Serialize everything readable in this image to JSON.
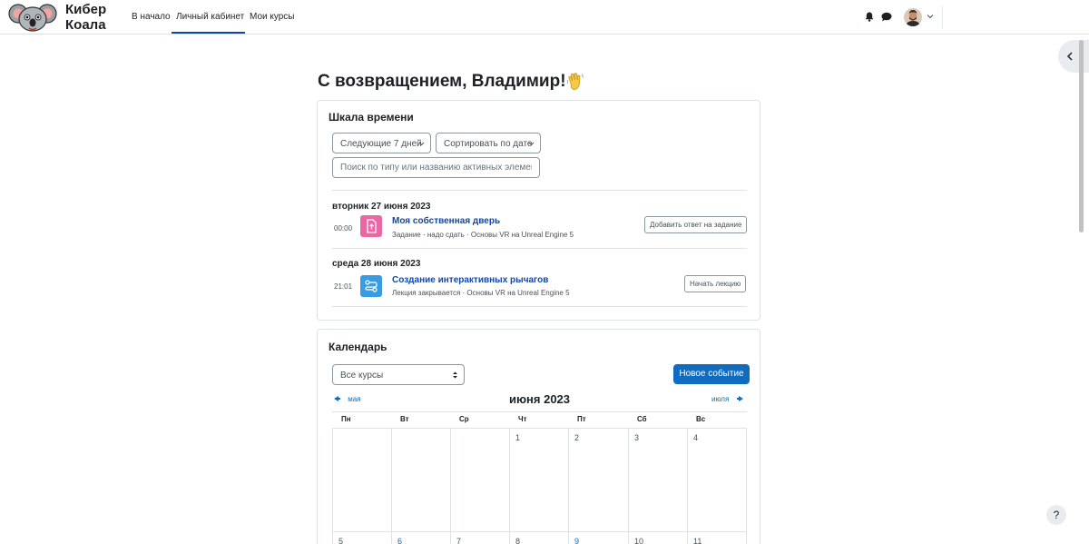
{
  "navbar": {
    "brand_line1": "Кибер",
    "brand_line2": "Коала",
    "links": [
      "В начало",
      "Личный кабинет",
      "Мои курсы"
    ]
  },
  "welcome": "С возвращением, Владимир!",
  "timeline": {
    "title": "Шкала времени",
    "filter_label": "Следующие 7 дней",
    "sort_label": "Сортировать по дате",
    "search_placeholder": "Поиск по типу или названию активных элемен",
    "groups": [
      {
        "date": "вторник 27 июня 2023",
        "time": "00:00",
        "title": "Моя собственная дверь",
        "subtitle": "Задание · надо сдать · Основы VR на Unreal Engine 5",
        "action": "Добавить ответ на задание",
        "icon_color": "#eb66a2"
      },
      {
        "date": "среда 28 июня 2023",
        "time": "21:01",
        "title": "Создание интерактивных рычагов",
        "subtitle": "Лекция закрывается · Основы VR на Unreal Engine 5",
        "action": "Начать лекцию",
        "icon_color": "#399be2"
      }
    ]
  },
  "calendar": {
    "title": "Календарь",
    "course_filter": "Все курсы",
    "new_event": "Новое событие",
    "month": "июня 2023",
    "prev": "мая",
    "next": "июля",
    "weekdays": [
      "Пн",
      "Вт",
      "Ср",
      "Чт",
      "Пт",
      "Сб",
      "Вс"
    ],
    "week1": [
      "",
      "",
      "",
      "1",
      "2",
      "3",
      "4"
    ],
    "week2": [
      "5",
      "6",
      "7",
      "8",
      "9",
      "10",
      "11"
    ]
  },
  "help": "?",
  "colors": {
    "primary": "#0f6cbf",
    "link": "#0f47ad",
    "border": "#dee2e6"
  }
}
